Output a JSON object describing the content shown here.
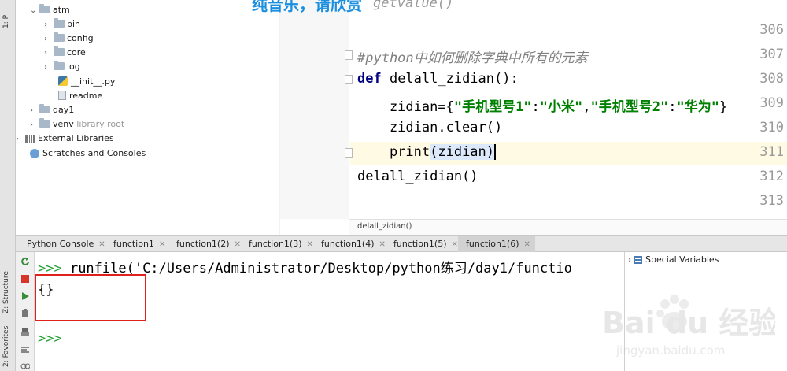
{
  "left_strip": {
    "project_label": "1: P",
    "structure_label": "Z: Structure",
    "favorites_label": "2: Favorites"
  },
  "overlay_title": "纯音乐，请欣赏",
  "project_tree": [
    {
      "name": "atm",
      "kind": "folder",
      "expanded": true,
      "indent": 1
    },
    {
      "name": "bin",
      "kind": "folder",
      "expanded": false,
      "indent": 2
    },
    {
      "name": "config",
      "kind": "folder",
      "expanded": false,
      "indent": 2
    },
    {
      "name": "core",
      "kind": "folder",
      "expanded": false,
      "indent": 2
    },
    {
      "name": "log",
      "kind": "folder",
      "expanded": false,
      "indent": 2
    },
    {
      "name": "__init__.py",
      "kind": "python-file",
      "indent": 3
    },
    {
      "name": "readme",
      "kind": "file",
      "indent": 3
    },
    {
      "name": "day1",
      "kind": "folder",
      "expanded": false,
      "indent": 1
    },
    {
      "name": "venv",
      "kind": "folder",
      "expanded": false,
      "indent": 1,
      "suffix": "library root"
    },
    {
      "name": "External Libraries",
      "kind": "libraries",
      "expanded": false,
      "indent": 0
    },
    {
      "name": "Scratches and Consoles",
      "kind": "scratches",
      "indent": 0
    }
  ],
  "editor": {
    "top_fragment": "getvalue()",
    "line_numbers": [
      "306",
      "307",
      "308",
      "309",
      "310",
      "311",
      "312",
      "313"
    ],
    "lines": {
      "l307_comment": "#python中如何删除字典中所有的元素",
      "l308_kw": "def",
      "l308_rest": " delall_zidian():",
      "l309_prefix": "    zidian={",
      "l309_k1": "\"手机型号1\"",
      "l309_colon1": ":",
      "l309_v1": "\"小米\"",
      "l309_comma": ",",
      "l309_k2": "\"手机型号2\"",
      "l309_colon2": ":",
      "l309_v2": "\"华为\"",
      "l309_suffix": "}",
      "l310": "    zidian.clear()",
      "l311_print": "    print",
      "l311_arg": "(zidian)",
      "l312": "delall_zidian()"
    },
    "current_line": "311",
    "breadcrumb": "delall_zidian()"
  },
  "tabs": [
    {
      "label": "Python Console",
      "active": false
    },
    {
      "label": "function1",
      "active": false
    },
    {
      "label": "function1(2)",
      "active": false
    },
    {
      "label": "function1(3)",
      "active": false
    },
    {
      "label": "function1(4)",
      "active": false
    },
    {
      "label": "function1(5)",
      "active": false
    },
    {
      "label": "function1(6)",
      "active": true
    }
  ],
  "console": {
    "prompt": ">>>",
    "command": " runfile('C:/Users/Administrator/Desktop/python练习/day1/functio",
    "output": "{}",
    "prompt2": ">>>"
  },
  "variables_panel": {
    "label": "Special Variables"
  },
  "watermark": {
    "brand": "Bai du 经验",
    "url": "jingyan.baidu.com"
  },
  "colors": {
    "accent_red": "#e0201b",
    "prompt_green": "#24a134",
    "keyword_navy": "#000080",
    "string_green": "#008000",
    "current_line": "#fffae3"
  }
}
